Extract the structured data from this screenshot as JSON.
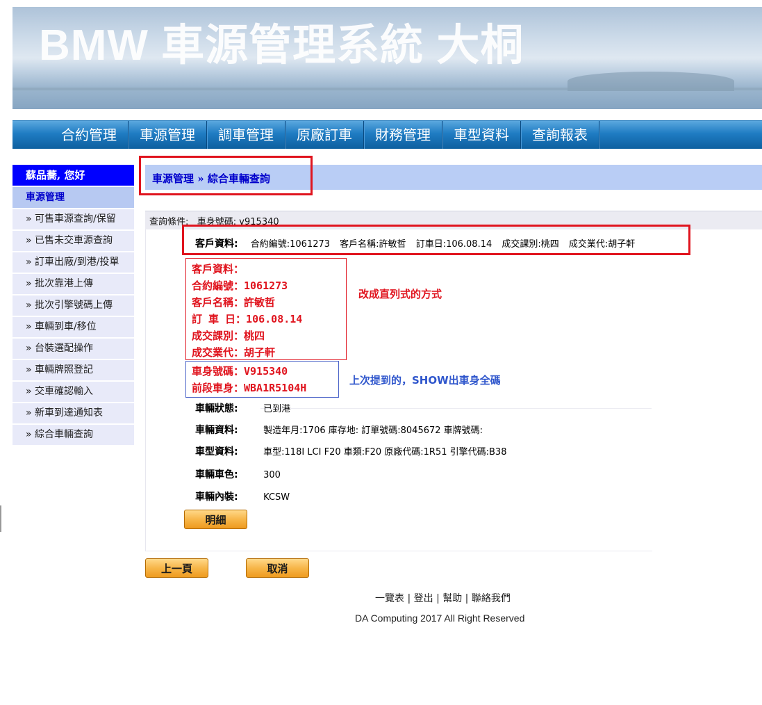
{
  "banner": {
    "title": "BMW 車源管理系統 大桐"
  },
  "nav": {
    "items": [
      "合約管理",
      "車源管理",
      "調車管理",
      "原廠訂車",
      "財務管理",
      "車型資料",
      "查詢報表"
    ]
  },
  "sidebar": {
    "greeting": "蘇品蕎, 您好",
    "section": "車源管理",
    "items": [
      "» 可售車源查詢/保留",
      "» 已售未交車源查詢",
      "» 訂車出廠/到港/投單",
      "» 批次靠港上傳",
      "» 批次引擎號碼上傳",
      "» 車輛到車/移位",
      "» 台裝選配操作",
      "» 車輛牌照登記",
      "» 交車確認輸入",
      "» 新車到達通知表",
      "» 綜合車輛查詢"
    ]
  },
  "breadcrumb": "車源管理 » 綜合車輛查詢",
  "query": {
    "label": "查詢條件:",
    "criteria": "車身號碼: v915340"
  },
  "customer": {
    "label": "客戶資料:",
    "contract_no": "合約編號:1061273",
    "name": "客戶名稱:許敏哲",
    "order_date": "訂車日:106.08.14",
    "branch": "成交課別:桃四",
    "sales": "成交業代:胡子軒"
  },
  "annotation_vertical": {
    "lines": [
      "客戶資料：",
      "合約編號：1061273",
      "客戶名稱：許敏哲",
      "訂 車 日：106.08.14",
      "成交課別：桃四",
      "成交業代：胡子軒"
    ],
    "note": "改成直列式的方式"
  },
  "annotation_vin": {
    "lines": [
      "車身號碼：V915340",
      "前段車身：WBA1R5104H"
    ],
    "note": "上次提到的，SHOW出車身全碼"
  },
  "details": {
    "status": {
      "label": "車輛狀態:",
      "value": "已到港"
    },
    "vehicle": {
      "label": "車輛資料:",
      "value": "製造年月:1706   庫存地:   訂單號碼:8045672   車牌號碼:"
    },
    "model": {
      "label": "車型資料:",
      "value": "車型:118I LCI F20   車類:F20   原廠代碼:1R51   引擎代碼:B38"
    },
    "color": {
      "label": "車輛車色:",
      "value": "300"
    },
    "interior": {
      "label": "車輛內裝:",
      "value": "KCSW"
    }
  },
  "buttons": {
    "detail": "明細",
    "prev": "上一頁",
    "cancel": "取消"
  },
  "footer": {
    "links": "一覽表 | 登出 | 幫助 | 聯絡我們",
    "copyright": "DA Computing 2017 All Right Reserved"
  }
}
